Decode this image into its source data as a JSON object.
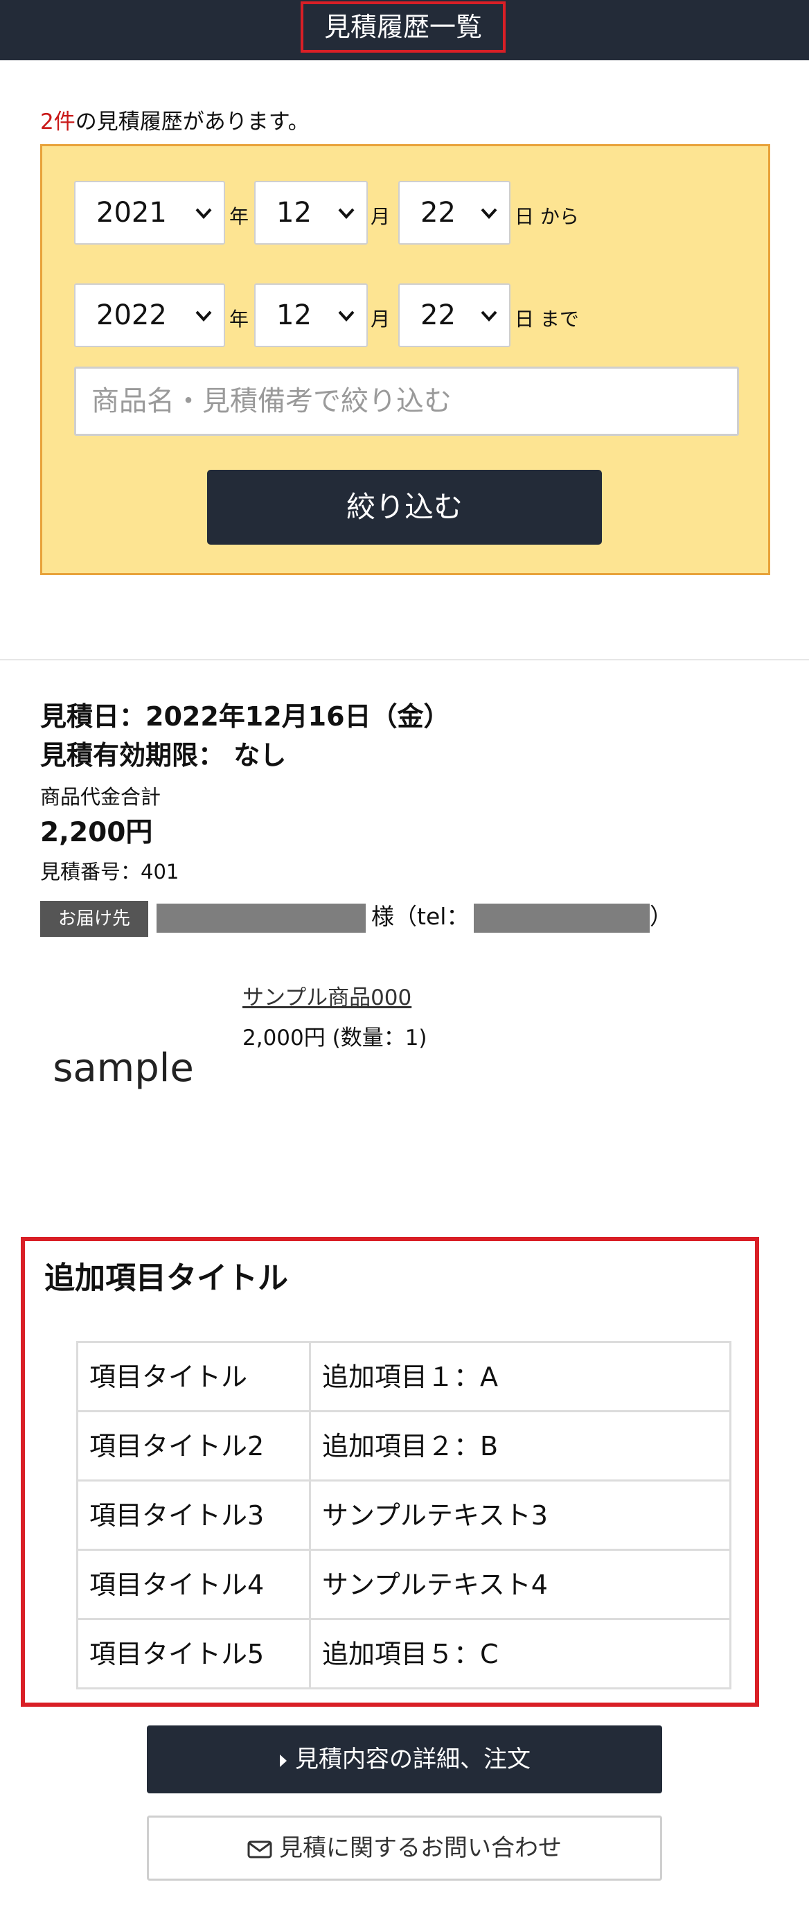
{
  "header": {
    "title": "見積履歴一覧"
  },
  "summary": {
    "count": "2件",
    "count_suffix": "の見積履歴があります。"
  },
  "filter": {
    "from": {
      "year": "2021",
      "month": "12",
      "day": "22",
      "year_unit": "年",
      "month_unit": "月",
      "day_unit": "日 から"
    },
    "to": {
      "year": "2022",
      "month": "12",
      "day": "22",
      "year_unit": "年",
      "month_unit": "月",
      "day_unit": "日 まで"
    },
    "keyword_placeholder": "商品名・見積備考で絞り込む",
    "submit_label": "絞り込む"
  },
  "quote": {
    "date": "見積日：2022年12月16日（金）",
    "expiry": "見積有効期限： なし",
    "subtotal_label": "商品代金合計",
    "subtotal": "2,200円",
    "number": "見積番号：401",
    "ship_label": "お届け先",
    "ship_honorific": "様（tel：",
    "ship_close": "）",
    "product": {
      "image_text": "sample",
      "name": "サンプル商品000",
      "price_qty": "2,000円 (数量：1)"
    }
  },
  "extra": {
    "title": "追加項目タイトル",
    "rows": [
      {
        "key": "項目タイトル",
        "value": "追加項目１：A"
      },
      {
        "key": "項目タイトル2",
        "value": "追加項目２：B"
      },
      {
        "key": "項目タイトル3",
        "value": "サンプルテキスト3"
      },
      {
        "key": "項目タイトル4",
        "value": "サンプルテキスト4"
      },
      {
        "key": "項目タイトル5",
        "value": "追加項目５：C"
      }
    ]
  },
  "actions": {
    "detail_label": "見積内容の詳細、注文",
    "contact_label": "見積に関するお問い合わせ"
  },
  "colors": {
    "header_bg": "#232b38",
    "accent_red": "#d91f26",
    "panel_bg": "#fde492",
    "panel_border": "#e8a23a"
  }
}
